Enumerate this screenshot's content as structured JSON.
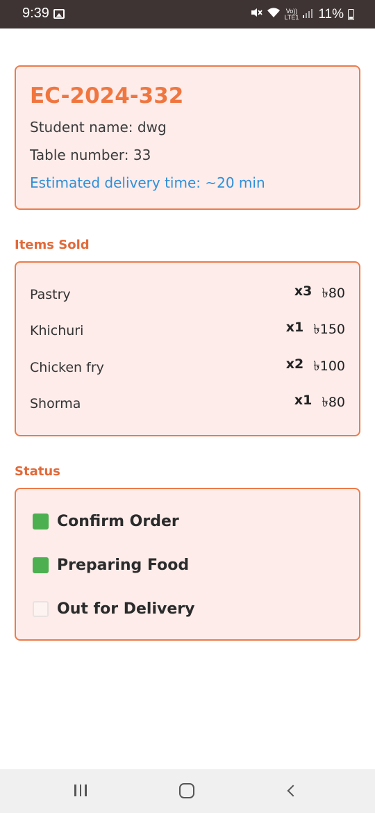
{
  "status_bar": {
    "time": "9:39",
    "network_label_top": "Vo))",
    "network_label_bottom": "LTE1",
    "battery_percent": "11%"
  },
  "order": {
    "id": "EC-2024-332",
    "student_name": "Student name: dwg",
    "table_number": "Table number: 33",
    "eta": "Estimated delivery time: ~20 min"
  },
  "items_section": {
    "title": "Items Sold",
    "items": [
      {
        "name": "Pastry",
        "qty": "x3",
        "price": "৳80"
      },
      {
        "name": "Khichuri",
        "qty": "x1",
        "price": "৳150"
      },
      {
        "name": "Chicken fry",
        "qty": "x2",
        "price": "৳100"
      },
      {
        "name": "Shorma",
        "qty": "x1",
        "price": "৳80"
      }
    ]
  },
  "status_section": {
    "title": "Status",
    "steps": [
      {
        "label": "Confirm Order",
        "checked": true
      },
      {
        "label": "Preparing Food",
        "checked": true
      },
      {
        "label": "Out for Delivery",
        "checked": false
      }
    ]
  },
  "colors": {
    "accent": "#f0763f",
    "card_bg": "#fdecea",
    "eta_blue": "#2f8fd8",
    "checked_green": "#4caf50"
  }
}
